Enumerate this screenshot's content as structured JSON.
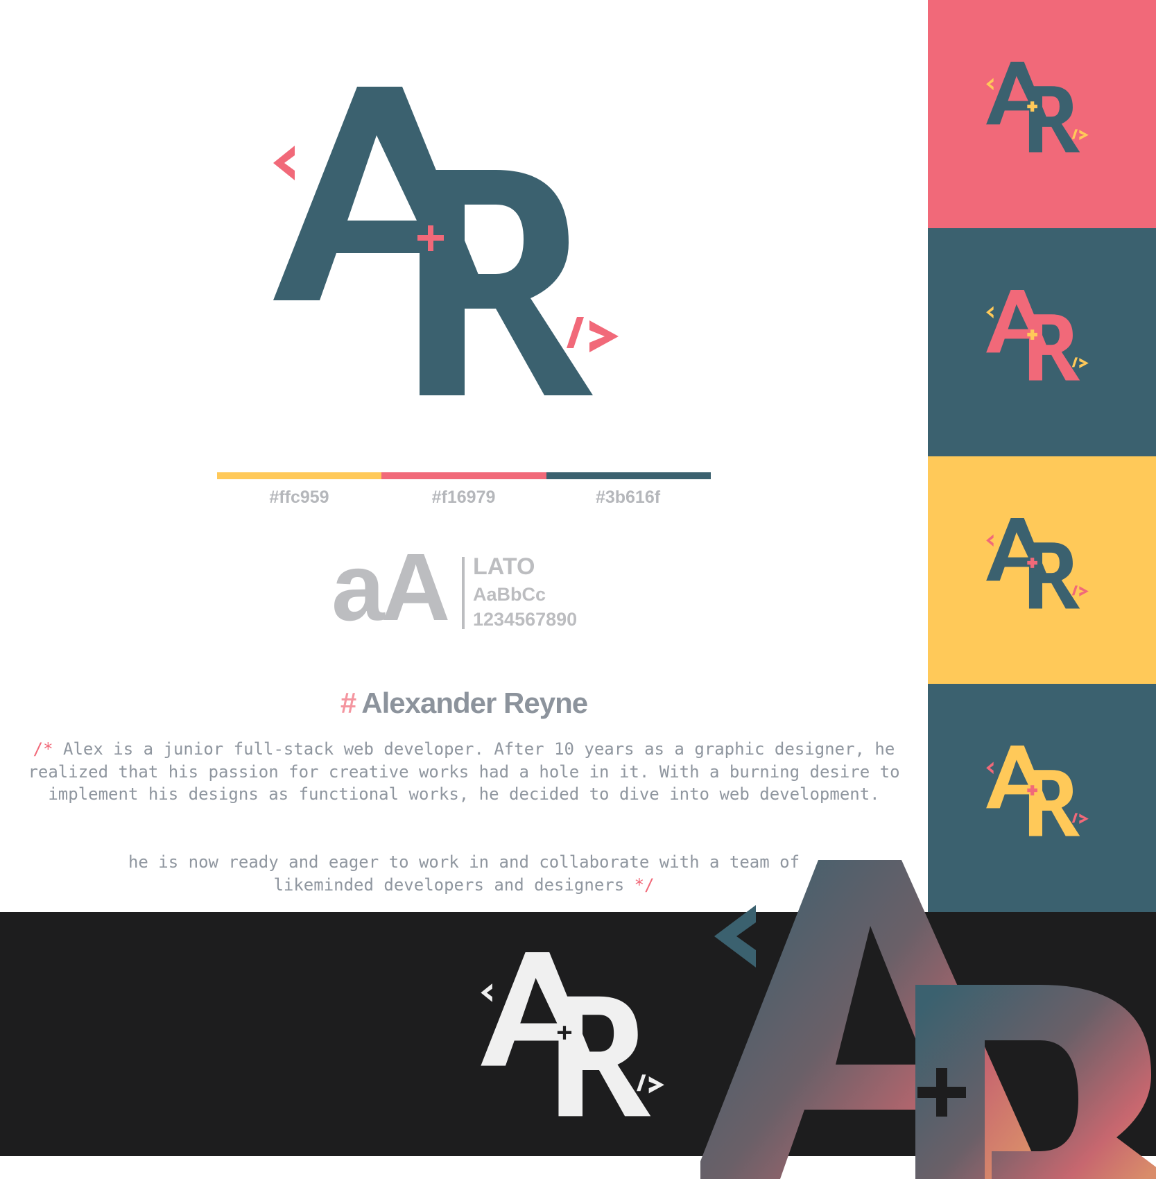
{
  "colors": {
    "yellow": "#ffc959",
    "pink": "#f16979",
    "teal": "#3b616f",
    "dark": "#1d1d1e",
    "gray": "#bcbdc0"
  },
  "logo": {
    "open_tag": "<",
    "close_tag": "/>",
    "plus": "+"
  },
  "palette": {
    "swatches": [
      {
        "hex": "#ffc959",
        "label": "#ffc959"
      },
      {
        "hex": "#f16979",
        "label": "#f16979"
      },
      {
        "hex": "#3b616f",
        "label": "#3b616f"
      }
    ]
  },
  "typography": {
    "sample": "aA",
    "font_name": "LATO",
    "alphabet": "AaBbCc",
    "numerals": "1234567890"
  },
  "profile": {
    "hash": "#",
    "name": "Alexander Reyne",
    "comment_open": "/*",
    "bio_1": " Alex is a junior full-stack web developer. After 10 years as a graphic designer, he realized that his passion for creative works had a hole in it. With a burning desire to implement his designs as functional works, he decided to dive into web development.",
    "bio_2": "he is now ready and eager to work in and collaborate with a team of likeminded developers and designers ",
    "comment_close": "*/"
  },
  "side_tiles": [
    {
      "bg": "#f16979",
      "letters": "#3b616f",
      "bracket_left": "#ffc959",
      "plus": "#ffc959",
      "bracket_right": "#ffc959"
    },
    {
      "bg": "#3b616f",
      "letters": "#f16979",
      "bracket_left": "#ffc959",
      "plus": "#ffc959",
      "bracket_right": "#ffc959"
    },
    {
      "bg": "#ffc959",
      "letters": "#3b616f",
      "bracket_left": "#f16979",
      "plus": "#f16979",
      "bracket_right": "#f16979"
    },
    {
      "bg": "#3b616f",
      "letters": "#ffc959",
      "bracket_left": "#f16979",
      "plus": "#f16979",
      "bracket_right": "#f16979"
    }
  ]
}
